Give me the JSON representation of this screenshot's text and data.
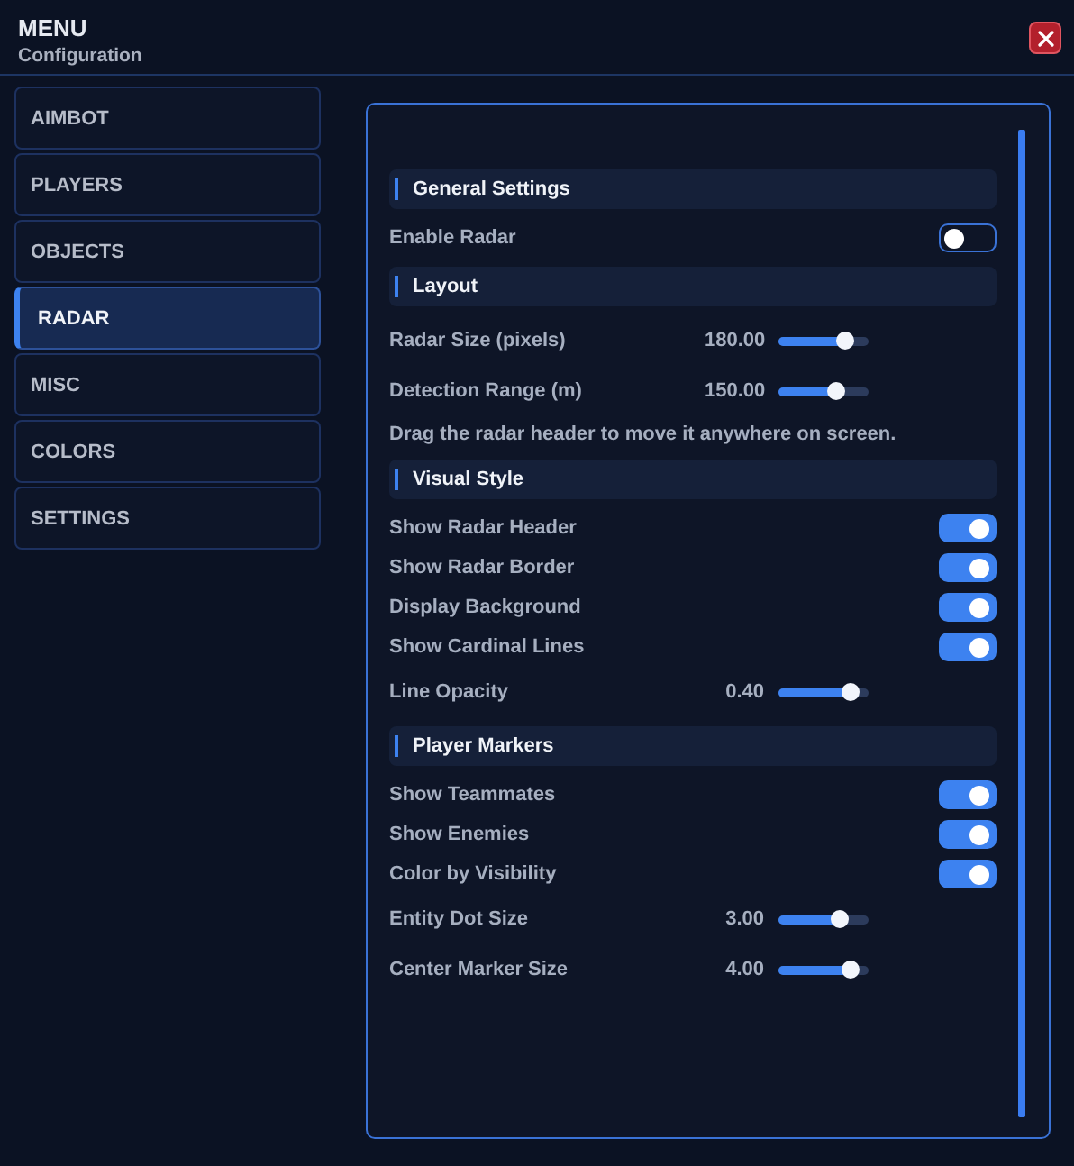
{
  "header": {
    "title": "MENU",
    "subtitle": "Configuration"
  },
  "sidebar": {
    "items": [
      {
        "label": "AIMBOT",
        "selected": false
      },
      {
        "label": "PLAYERS",
        "selected": false
      },
      {
        "label": "OBJECTS",
        "selected": false
      },
      {
        "label": "RADAR",
        "selected": true
      },
      {
        "label": "MISC",
        "selected": false
      },
      {
        "label": "COLORS",
        "selected": false
      },
      {
        "label": "SETTINGS",
        "selected": false
      }
    ]
  },
  "settings": [
    {
      "kind": "section",
      "label": "General Settings"
    },
    {
      "kind": "toggle",
      "label": "Enable Radar",
      "on": false
    },
    {
      "kind": "section",
      "label": "Layout"
    },
    {
      "kind": "slider",
      "label": "Radar Size (pixels)",
      "reading": "180.00",
      "level": 0.74
    },
    {
      "kind": "slider",
      "label": "Detection Range (m)",
      "reading": "150.00",
      "level": 0.64
    },
    {
      "kind": "note",
      "label": "Drag the radar header to move it anywhere on screen."
    },
    {
      "kind": "section",
      "label": "Visual Style"
    },
    {
      "kind": "toggle",
      "label": "Show Radar Header",
      "on": true
    },
    {
      "kind": "toggle",
      "label": "Show Radar Border",
      "on": true
    },
    {
      "kind": "toggle",
      "label": "Display Background",
      "on": true
    },
    {
      "kind": "toggle",
      "label": "Show Cardinal Lines",
      "on": true
    },
    {
      "kind": "slider",
      "label": "Line Opacity",
      "reading": "0.40",
      "level": 0.8
    },
    {
      "kind": "section",
      "label": "Player Markers"
    },
    {
      "kind": "toggle",
      "label": "Show Teammates",
      "on": true
    },
    {
      "kind": "toggle",
      "label": "Show Enemies",
      "on": true
    },
    {
      "kind": "toggle",
      "label": "Color by Visibility",
      "on": true
    },
    {
      "kind": "slider",
      "label": "Entity Dot Size",
      "reading": "3.00",
      "level": 0.68
    },
    {
      "kind": "slider",
      "label": "Center Marker Size",
      "reading": "4.00",
      "level": 0.8
    }
  ]
}
